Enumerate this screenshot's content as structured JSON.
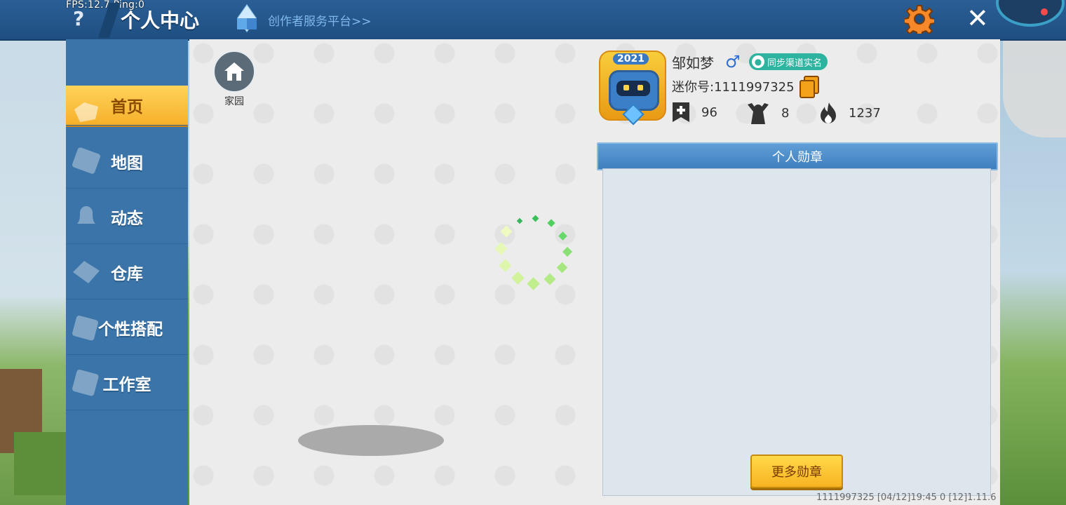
{
  "status": {
    "fps_text": "FPS:12.7",
    "ping_text": "Ping:0"
  },
  "header": {
    "help_icon": "?",
    "title": "个人中心",
    "creator_link": "创作者服务平台>>",
    "settings_icon": "gear-icon",
    "close_icon": "✕"
  },
  "sidebar": {
    "items": [
      {
        "label": "首页",
        "icon": "hand-icon",
        "active": true
      },
      {
        "label": "地图",
        "icon": "map-icon"
      },
      {
        "label": "动态",
        "icon": "bell-icon"
      },
      {
        "label": "仓库",
        "icon": "box-icon"
      },
      {
        "label": "个性搭配",
        "icon": "outfit-icon"
      },
      {
        "label": "工作室",
        "icon": "studio-icon"
      }
    ]
  },
  "home": {
    "label": "家园"
  },
  "profile": {
    "avatar_year": "2021",
    "name": "邹如梦",
    "gender_symbol": "♂",
    "realname_badge": "同步渠道实名",
    "mini_id": "迷你号:1111997325",
    "stats": [
      {
        "icon": "add-friend-icon",
        "value": "96"
      },
      {
        "icon": "fans-icon",
        "value": "8"
      },
      {
        "icon": "fire-icon",
        "value": "1237"
      }
    ]
  },
  "medals": {
    "title": "个人勋章",
    "more_button": "更多勋章"
  },
  "footer": {
    "text": "1111997325     [04/12]19:45 0  [12]1.11.6"
  },
  "colors": {
    "topbar": "#1f4f82",
    "sidebar": "#3a74a8",
    "active": "#f6b02a",
    "medal_header": "#3f7fbf"
  }
}
